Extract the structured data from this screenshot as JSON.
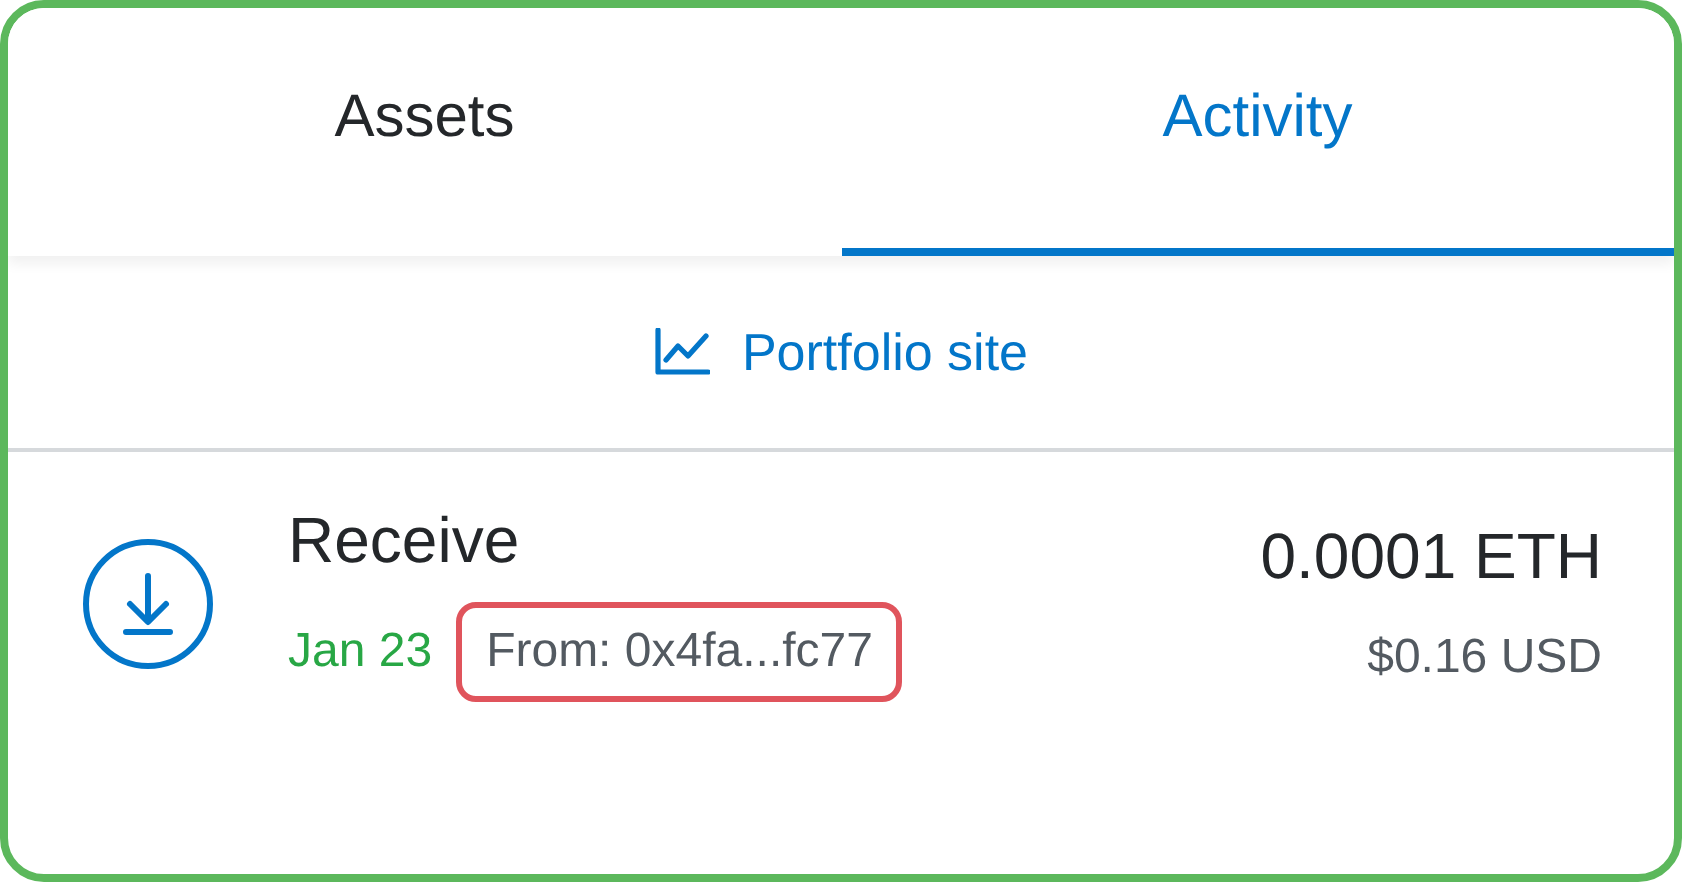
{
  "tabs": [
    {
      "label": "Assets",
      "selected": false
    },
    {
      "label": "Activity",
      "selected": true
    }
  ],
  "portfolio_link": {
    "label": "Portfolio site"
  },
  "transactions": [
    {
      "kind": "receive",
      "title": "Receive",
      "date": "Jan 23",
      "from": "From: 0x4fa...fc77",
      "from_highlighted": true,
      "amount": "0.0001 ETH",
      "fiat": "$0.16 USD"
    }
  ]
}
